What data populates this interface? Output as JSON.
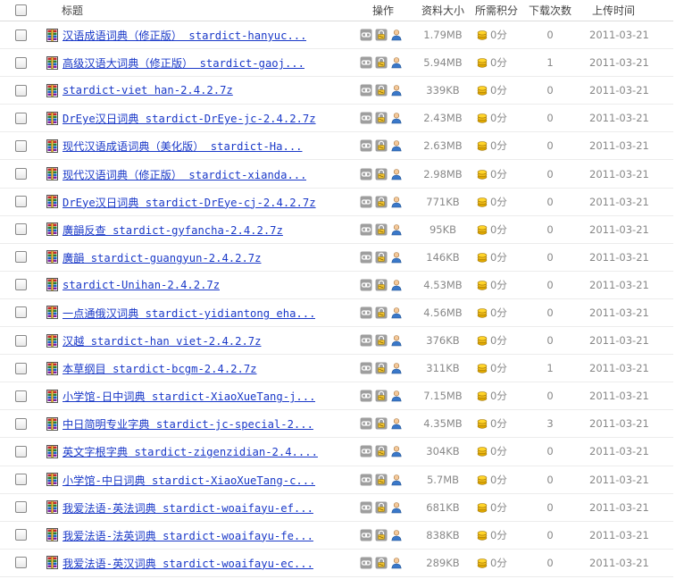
{
  "header": {
    "title": "标题",
    "ops": "操作",
    "size": "资料大小",
    "points": "所需积分",
    "downloads": "下载次数",
    "date": "上传时间"
  },
  "icons": {
    "file": "rar-archive-icon",
    "op1": "link-icon",
    "op2": "lock-icon",
    "op3": "user-icon",
    "points": "coin-icon"
  },
  "colors": {
    "link": "#1a39c8",
    "meta": "#888888"
  },
  "rows": [
    {
      "title": "汉语成语词典（修正版） stardict-hanyuc...",
      "size": "1.79MB",
      "points": "0分",
      "downloads": "0",
      "date": "2011-03-21"
    },
    {
      "title": "高级汉语大词典（修正版） stardict-gaoj...",
      "size": "5.94MB",
      "points": "0分",
      "downloads": "1",
      "date": "2011-03-21"
    },
    {
      "title": "stardict-viet han-2.4.2.7z",
      "size": "339KB",
      "points": "0分",
      "downloads": "0",
      "date": "2011-03-21"
    },
    {
      "title": "DrEye汉日词典 stardict-DrEye-jc-2.4.2.7z",
      "size": "2.43MB",
      "points": "0分",
      "downloads": "0",
      "date": "2011-03-21"
    },
    {
      "title": "现代汉语成语词典（美化版） stardict-Ha...",
      "size": "2.63MB",
      "points": "0分",
      "downloads": "0",
      "date": "2011-03-21"
    },
    {
      "title": "现代汉语词典（修正版） stardict-xianda...",
      "size": "2.98MB",
      "points": "0分",
      "downloads": "0",
      "date": "2011-03-21"
    },
    {
      "title": "DrEye汉日词典 stardict-DrEye-cj-2.4.2.7z",
      "size": "771KB",
      "points": "0分",
      "downloads": "0",
      "date": "2011-03-21"
    },
    {
      "title": "廣韻反查 stardict-gyfancha-2.4.2.7z",
      "size": "95KB",
      "points": "0分",
      "downloads": "0",
      "date": "2011-03-21"
    },
    {
      "title": "廣韻 stardict-guangyun-2.4.2.7z",
      "size": "146KB",
      "points": "0分",
      "downloads": "0",
      "date": "2011-03-21"
    },
    {
      "title": "stardict-Unihan-2.4.2.7z",
      "size": "4.53MB",
      "points": "0分",
      "downloads": "0",
      "date": "2011-03-21"
    },
    {
      "title": "一点通俄汉词典 stardict-yidiantong eha...",
      "size": "4.56MB",
      "points": "0分",
      "downloads": "0",
      "date": "2011-03-21"
    },
    {
      "title": "汉越 stardict-han viet-2.4.2.7z",
      "size": "376KB",
      "points": "0分",
      "downloads": "0",
      "date": "2011-03-21"
    },
    {
      "title": "本草纲目 stardict-bcgm-2.4.2.7z",
      "size": "311KB",
      "points": "0分",
      "downloads": "1",
      "date": "2011-03-21"
    },
    {
      "title": "小学馆-日中词典 stardict-XiaoXueTang-j...",
      "size": "7.15MB",
      "points": "0分",
      "downloads": "0",
      "date": "2011-03-21"
    },
    {
      "title": "中日简明专业字典 stardict-jc-special-2...",
      "size": "4.35MB",
      "points": "0分",
      "downloads": "3",
      "date": "2011-03-21"
    },
    {
      "title": "英文字根字典 stardict-zigenzidian-2.4....",
      "size": "304KB",
      "points": "0分",
      "downloads": "0",
      "date": "2011-03-21"
    },
    {
      "title": "小学馆-中日词典 stardict-XiaoXueTang-c...",
      "size": "5.7MB",
      "points": "0分",
      "downloads": "0",
      "date": "2011-03-21"
    },
    {
      "title": "我爱法语-英法词典 stardict-woaifayu-ef...",
      "size": "681KB",
      "points": "0分",
      "downloads": "0",
      "date": "2011-03-21"
    },
    {
      "title": "我爱法语-法英词典 stardict-woaifayu-fe...",
      "size": "838KB",
      "points": "0分",
      "downloads": "0",
      "date": "2011-03-21"
    },
    {
      "title": "我爱法语-英汉词典 stardict-woaifayu-ec...",
      "size": "289KB",
      "points": "0分",
      "downloads": "0",
      "date": "2011-03-21"
    }
  ]
}
